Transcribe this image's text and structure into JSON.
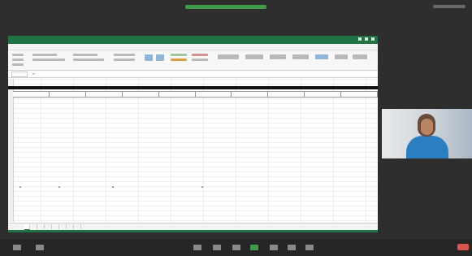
{
  "window": {
    "title": ""
  },
  "ribbon": {
    "tabs": [
      {
        "label": ""
      },
      {
        "label": ""
      },
      {
        "label": ""
      },
      {
        "label": ""
      },
      {
        "label": ""
      },
      {
        "label": ""
      },
      {
        "label": ""
      },
      {
        "label": ""
      }
    ]
  },
  "formula_bar": {
    "name_box": "",
    "fx": "fx"
  },
  "sheet": {
    "band_label": ""
  },
  "sheet_tabs": [
    {
      "label": ""
    },
    {
      "label": ""
    },
    {
      "label": ""
    },
    {
      "label": ""
    },
    {
      "label": ""
    },
    {
      "label": ""
    },
    {
      "label": ""
    },
    {
      "label": ""
    }
  ],
  "colors": {
    "excel_green": "#217346",
    "share_green": "#3f9a49",
    "end_red": "#d9534f"
  }
}
